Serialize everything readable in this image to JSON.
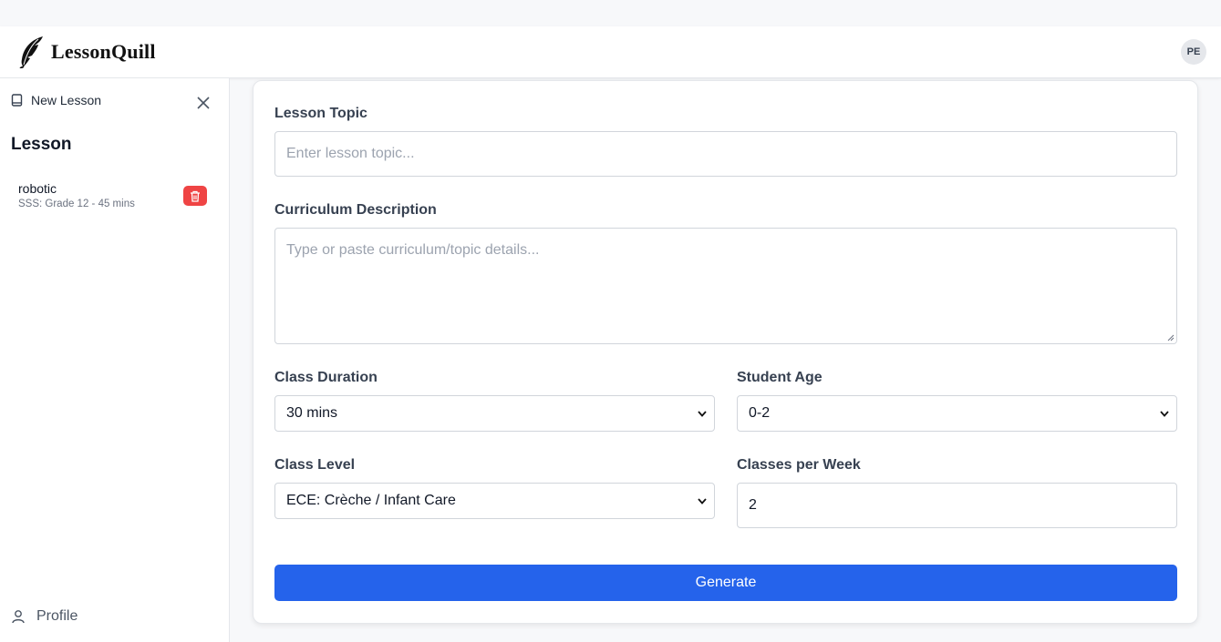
{
  "app": {
    "name": "LessonQuill",
    "user_initials": "PE",
    "accent": "#2563eb",
    "danger": "#ef4444"
  },
  "sidebar": {
    "new_lesson_label": "New Lesson",
    "section_title": "Lesson",
    "lessons": [
      {
        "name": "robotic",
        "meta": "SSS: Grade 12 - 45 mins"
      }
    ],
    "profile_label": "Profile"
  },
  "form": {
    "topic": {
      "label": "Lesson Topic",
      "value": "",
      "placeholder": "Enter lesson topic..."
    },
    "curriculum": {
      "label": "Curriculum Description",
      "value": "",
      "placeholder": "Type or paste curriculum/topic details..."
    },
    "duration": {
      "label": "Class Duration",
      "selected": "30 mins"
    },
    "age": {
      "label": "Student Age",
      "selected": "0-2"
    },
    "level": {
      "label": "Class Level",
      "selected": "ECE: Crèche / Infant Care"
    },
    "per_week": {
      "label": "Classes per Week",
      "value": "2"
    },
    "generate_label": "Generate"
  },
  "icons": {
    "logo": "quill-feather-icon",
    "new_lesson": "book-icon",
    "close": "close-icon",
    "delete": "trash-icon",
    "profile": "user-icon",
    "select": "chevron-down-icon"
  }
}
